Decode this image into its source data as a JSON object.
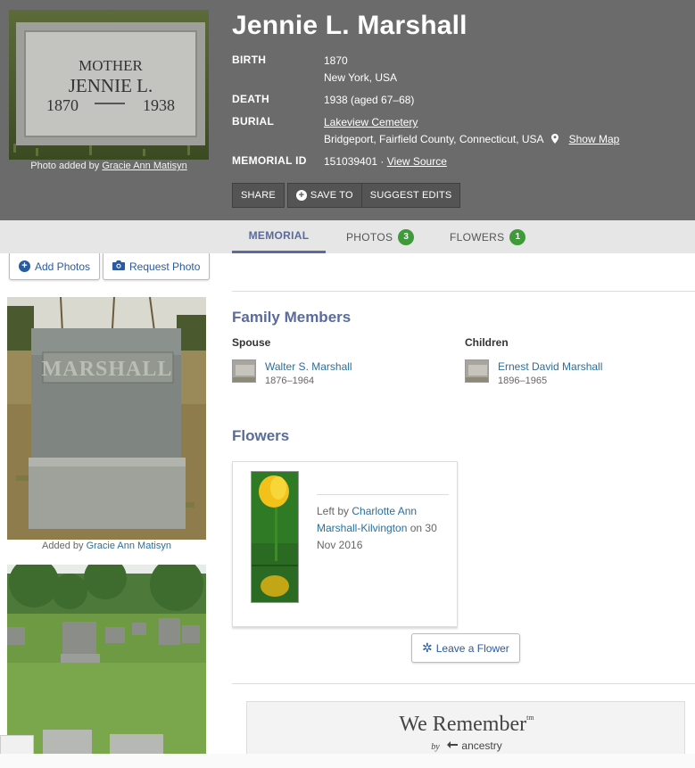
{
  "header": {
    "name": "Jennie L. Marshall",
    "photo_caption_prefix": "Photo added by",
    "photo_added_by": "Gracie Ann Matisyn",
    "headstone_text": {
      "line1": "MOTHER",
      "line2": "JENNIE L.",
      "birth_year": "1870",
      "death_year": "1938"
    },
    "facts": {
      "birth_label": "BIRTH",
      "birth_date": "1870",
      "birth_place": "New York, USA",
      "death_label": "DEATH",
      "death_value": "1938 (aged 67–68)",
      "burial_label": "BURIAL",
      "cemetery": "Lakeview Cemetery",
      "burial_place": "Bridgeport, Fairfield County, Connecticut, USA",
      "show_map": "Show Map",
      "memorial_label": "MEMORIAL ID",
      "memorial_id": "151039401 ·",
      "view_source": "View Source"
    },
    "actions": {
      "share": "SHARE",
      "save_to": "SAVE TO",
      "suggest_edits": "SUGGEST EDITS"
    }
  },
  "tabs": [
    {
      "label": "MEMORIAL",
      "active": true
    },
    {
      "label": "PHOTOS",
      "count": "3"
    },
    {
      "label": "FLOWERS",
      "count": "1"
    }
  ],
  "sidebar": {
    "add_photos": "Add Photos",
    "request_photo": "Request Photo",
    "photo1_caption_prefix": "Added by",
    "photo1_added_by": "Gracie Ann Matisyn",
    "headstone_family_name": "MARSHALL"
  },
  "family": {
    "title": "Family Members",
    "spouse_label": "Spouse",
    "spouse_name": "Walter S. Marshall",
    "spouse_dates": "1876–1964",
    "children_label": "Children",
    "child_name": "Ernest David Marshall",
    "child_dates": "1896–1965"
  },
  "flowers": {
    "title": "Flowers",
    "left_by_prefix": "Left by",
    "left_by_name": "Charlotte Ann Marshall-Kilvington",
    "date_text": "on 30 Nov 2016",
    "leave_button": "Leave a Flower"
  },
  "ancestry": {
    "we_remember": "We Remember",
    "tm": "tm",
    "by": "by",
    "brand": "ancestry"
  },
  "colors": {
    "header_bg": "#6b6b6b",
    "accent": "#5a6b9c",
    "link": "#2a6f9c",
    "badge_green": "#3f9b3a"
  }
}
